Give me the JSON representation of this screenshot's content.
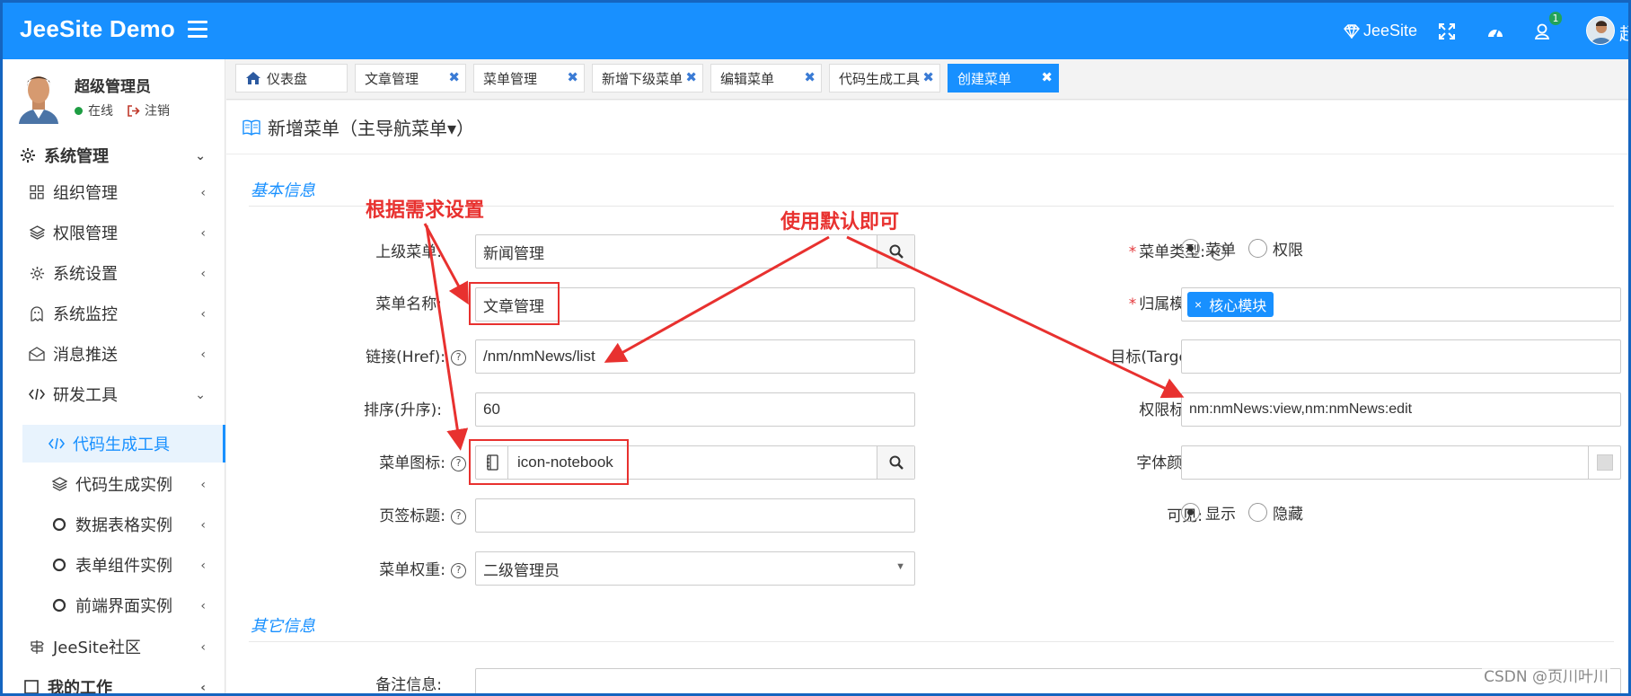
{
  "app": {
    "brand": "JeeSite Demo"
  },
  "topbar": {
    "jeesite_label": "JeeSite",
    "notification_count": "1",
    "user_initial": "超"
  },
  "user": {
    "name": "超级管理员",
    "status": "在线",
    "logout": "注销"
  },
  "sidebar": {
    "items": [
      {
        "label": "系统管理",
        "icon": "gear-icon"
      },
      {
        "label": "组织管理",
        "icon": "grid-icon"
      },
      {
        "label": "权限管理",
        "icon": "layers-icon"
      },
      {
        "label": "系统设置",
        "icon": "gear-icon"
      },
      {
        "label": "系统监控",
        "icon": "ghost-icon"
      },
      {
        "label": "消息推送",
        "icon": "mail-icon"
      },
      {
        "label": "研发工具",
        "icon": "code-icon"
      },
      {
        "label": "代码生成工具",
        "icon": "code-icon"
      },
      {
        "label": "代码生成实例",
        "icon": "layers-icon"
      },
      {
        "label": "数据表格实例",
        "icon": "circle-icon"
      },
      {
        "label": "表单组件实例",
        "icon": "circle-icon"
      },
      {
        "label": "前端界面实例",
        "icon": "circle-icon"
      },
      {
        "label": "JeeSite社区",
        "icon": "signpost-icon"
      },
      {
        "label": "我的工作",
        "icon": "square-icon"
      }
    ]
  },
  "tabs": [
    {
      "label": "仪表盘",
      "icon": "home-icon"
    },
    {
      "label": "文章管理"
    },
    {
      "label": "菜单管理"
    },
    {
      "label": "新增下级菜单"
    },
    {
      "label": "编辑菜单"
    },
    {
      "label": "代码生成工具"
    },
    {
      "label": "创建菜单",
      "active": true
    }
  ],
  "page": {
    "title": "新增菜单（主导航菜单▾）"
  },
  "sections": {
    "basic": "基本信息",
    "other": "其它信息"
  },
  "form": {
    "parent_menu": {
      "label": "上级菜单:",
      "value": "新闻管理"
    },
    "menu_name": {
      "label": "菜单名称:",
      "value": "文章管理"
    },
    "href": {
      "label": "链接(Href):",
      "value": "/nm/nmNews/list"
    },
    "sort": {
      "label": "排序(升序):",
      "value": "60"
    },
    "icon": {
      "label": "菜单图标:",
      "value": "icon-notebook"
    },
    "tab_title": {
      "label": "页签标题:",
      "value": ""
    },
    "weight": {
      "label": "菜单权重:",
      "value": "二级管理员"
    },
    "menu_type": {
      "label": "菜单类型:",
      "options": [
        "菜单",
        "权限"
      ],
      "selected": "菜单"
    },
    "module": {
      "label": "归属模块:",
      "tag": "核心模块"
    },
    "target": {
      "label": "目标(Target):",
      "value": ""
    },
    "permission": {
      "label": "权限标识:",
      "value": "nm:nmNews:view,nm:nmNews:edit"
    },
    "font_color": {
      "label": "字体颜色:",
      "value": ""
    },
    "visible": {
      "label": "可见:",
      "options": [
        "显示",
        "隐藏"
      ],
      "selected": "显示"
    },
    "remarks": {
      "label": "备注信息:"
    }
  },
  "annotations": {
    "left": "根据需求设置",
    "right": "使用默认即可"
  },
  "watermark": "CSDN @页川叶川",
  "colors": {
    "topbar": "#1890ff",
    "annotation": "#e8312f",
    "tag": "#1890ff"
  }
}
